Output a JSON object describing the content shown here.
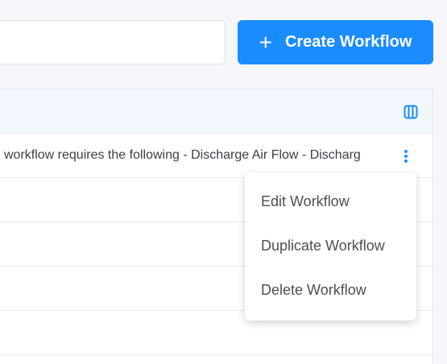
{
  "toolbar": {
    "search_placeholder": "",
    "create_button_icon": "plus-icon",
    "create_button_label": "Create Workflow",
    "accent_color": "#1a8cff"
  },
  "table": {
    "header_icon": "columns-icon",
    "rows": [
      {
        "description": "workflow requires the following - Discharge Air Flow - Discharg"
      },
      {
        "description": ""
      },
      {
        "description": ""
      },
      {
        "description": ""
      },
      {
        "description": ""
      }
    ]
  },
  "row_menu": {
    "items": [
      {
        "label": "Edit Workflow"
      },
      {
        "label": "Duplicate Workflow"
      },
      {
        "label": "Delete Workflow"
      }
    ]
  }
}
